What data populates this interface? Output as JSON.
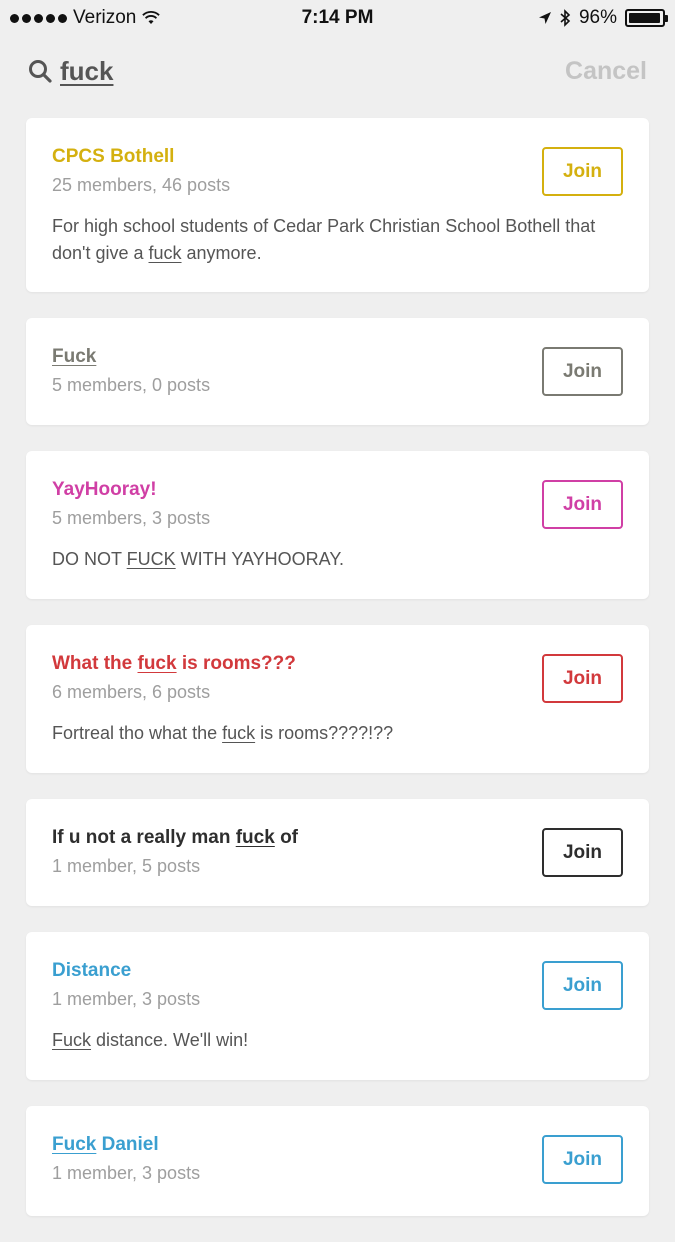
{
  "status": {
    "carrier": "Verizon",
    "time": "7:14 PM",
    "battery": "96%",
    "battery_level": 0.96
  },
  "search": {
    "query": "fuck",
    "cancel_label": "Cancel"
  },
  "rooms": [
    {
      "title_parts": [
        {
          "t": "CPCS Bothell",
          "u": false
        }
      ],
      "meta": "25 members, 46 posts",
      "desc_parts": [
        {
          "t": "For high school students of Cedar Park Christian School Bothell that don't give a ",
          "u": false
        },
        {
          "t": "fuck",
          "u": true
        },
        {
          "t": " anymore.",
          "u": false
        }
      ],
      "color": "#d4b00f",
      "join_label": "Join"
    },
    {
      "title_parts": [
        {
          "t": "Fuck",
          "u": true
        }
      ],
      "meta": "5 members, 0 posts",
      "desc_parts": [],
      "color": "#7a7a72",
      "join_label": "Join"
    },
    {
      "title_parts": [
        {
          "t": "YayHooray!",
          "u": false
        }
      ],
      "meta": "5 members, 3 posts",
      "desc_parts": [
        {
          "t": "DO NOT ",
          "u": false
        },
        {
          "t": "FUCK",
          "u": true
        },
        {
          "t": " WITH YAYHOORAY.",
          "u": false
        }
      ],
      "color": "#d03fa5",
      "join_label": "Join"
    },
    {
      "title_parts": [
        {
          "t": "What the ",
          "u": false
        },
        {
          "t": "fuck",
          "u": true
        },
        {
          "t": " is rooms???",
          "u": false
        }
      ],
      "meta": "6 members, 6 posts",
      "desc_parts": [
        {
          "t": "Fortreal tho what the ",
          "u": false
        },
        {
          "t": "fuck",
          "u": true
        },
        {
          "t": " is rooms????!??",
          "u": false
        }
      ],
      "color": "#d2393c",
      "join_label": "Join"
    },
    {
      "title_parts": [
        {
          "t": "If u not a really man ",
          "u": false
        },
        {
          "t": "fuck",
          "u": true
        },
        {
          "t": " of",
          "u": false
        }
      ],
      "meta": "1 member, 5 posts",
      "desc_parts": [],
      "color": "#2e2e2e",
      "join_label": "Join"
    },
    {
      "title_parts": [
        {
          "t": "Distance",
          "u": false
        }
      ],
      "meta": "1 member, 3 posts",
      "desc_parts": [
        {
          "t": "Fuck",
          "u": true
        },
        {
          "t": " distance. We'll win!",
          "u": false
        }
      ],
      "color": "#3a9fd0",
      "join_label": "Join"
    },
    {
      "title_parts": [
        {
          "t": "Fuck",
          "u": true
        },
        {
          "t": " Daniel",
          "u": false
        }
      ],
      "meta": "1 member, 3 posts",
      "desc_parts": [],
      "color": "#3a9fd0",
      "join_label": "Join"
    }
  ]
}
